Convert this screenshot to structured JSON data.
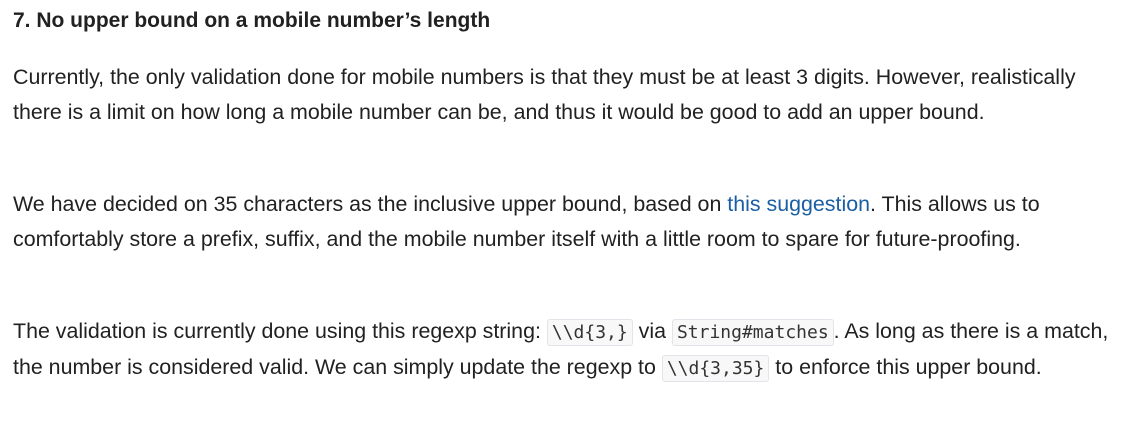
{
  "section": {
    "heading": "7. No upper bound on a mobile number’s length",
    "p1": "Currently, the only validation done for mobile numbers is that they must be at least 3 digits. However, realistically there is a limit on how long a mobile number can be, and thus it would be good to add an upper bound.",
    "p2": {
      "before": "We have decided on 35 characters as the inclusive upper bound, based on ",
      "link": "this suggestion",
      "after": ". This allows us to comfortably store a prefix, suffix, and the mobile number itself with a little room to spare for future-proofing."
    },
    "p3": {
      "t1": "The validation is currently done using this regexp string: ",
      "code1": "\\\\d{3,}",
      "t2": " via ",
      "code2": "String#matches",
      "t3": ". As long as there is a match, the number is considered valid. We can simply update the regexp to ",
      "code3": "\\\\d{3,35}",
      "t4": " to enforce this upper bound."
    }
  }
}
